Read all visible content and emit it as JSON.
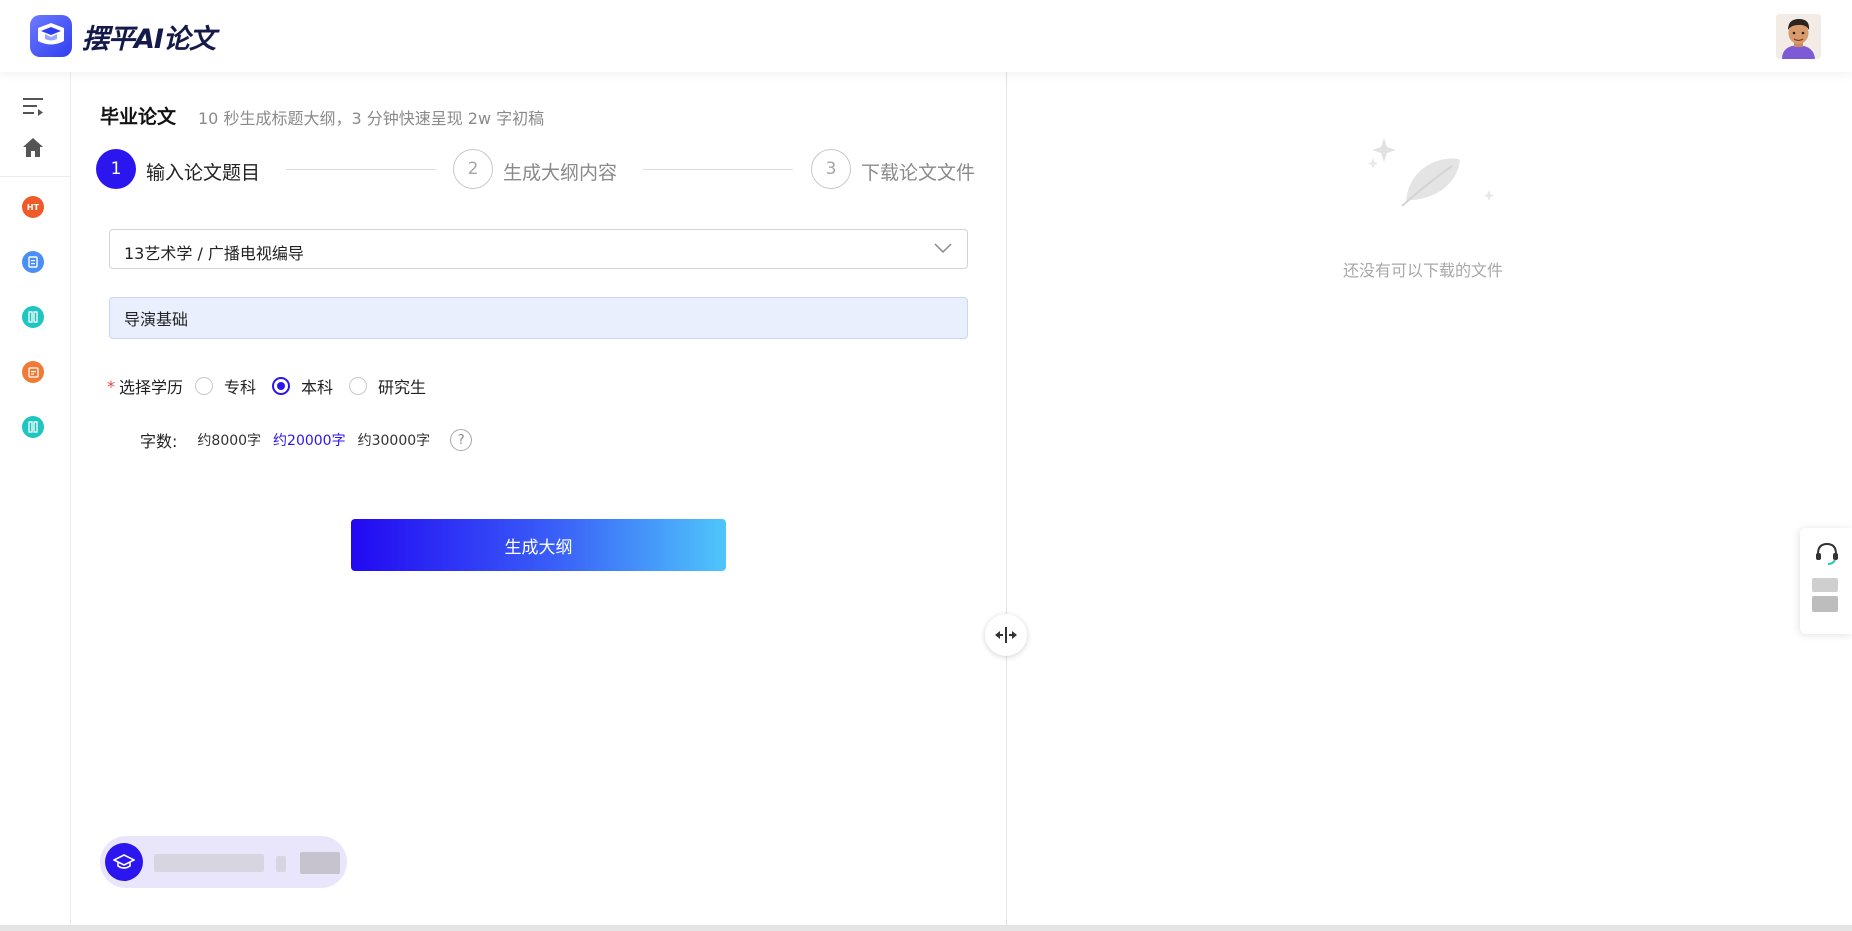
{
  "header": {
    "brand": "摆平AI论文"
  },
  "sidebar": {
    "items": [
      {
        "name": "menu-toggle-icon"
      },
      {
        "name": "home-icon"
      },
      {
        "name": "hot-icon",
        "label": "HT",
        "color": "#f05a28"
      },
      {
        "name": "document-icon",
        "color": "#4a8ff5"
      },
      {
        "name": "columns-icon",
        "color": "#1fc5c0"
      },
      {
        "name": "report-icon",
        "color": "#f07a36"
      },
      {
        "name": "columns-icon-2",
        "color": "#1fc5c0"
      }
    ]
  },
  "main": {
    "title": "毕业论文",
    "subtitle": "10 秒生成标题大纲，3 分钟快速呈现 2w 字初稿",
    "steps": [
      {
        "num": "1",
        "label": "输入论文题目",
        "active": true
      },
      {
        "num": "2",
        "label": "生成大纲内容",
        "active": false
      },
      {
        "num": "3",
        "label": "下载论文文件",
        "active": false
      }
    ],
    "major_select": "13艺术学 / 广播电视编导",
    "topic_value": "导演基础",
    "edu_label": "选择学历",
    "edu_required_mark": "*",
    "edu_options": [
      "专科",
      "本科",
      "研究生"
    ],
    "edu_selected": "本科",
    "words_label": "字数:",
    "words_options": [
      "约8000字",
      "约20000字",
      "约30000字"
    ],
    "words_selected": "约20000字",
    "help_symbol": "?",
    "generate_button": "生成大纲"
  },
  "right_panel": {
    "empty_text": "还没有可以下载的文件"
  },
  "colors": {
    "accent": "#2b16f0",
    "button_gradient_start": "#2208f2",
    "button_gradient_end": "#4fc6fb"
  }
}
